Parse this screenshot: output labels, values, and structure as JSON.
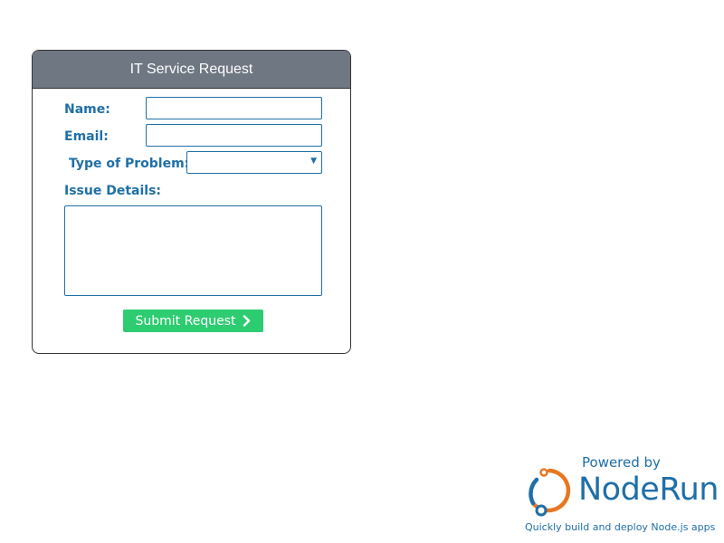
{
  "form": {
    "title": "IT Service Request",
    "name_label": "Name:",
    "name_value": "",
    "email_label": "Email:",
    "email_value": "",
    "problem_label": "Type of Problem:",
    "problem_selected": "",
    "details_label": "Issue Details:",
    "details_value": "",
    "submit_label": "Submit Request"
  },
  "branding": {
    "powered_by": "Powered by",
    "name": "NodeRun",
    "tagline": "Quickly build and deploy Node.js apps"
  },
  "colors": {
    "header_bg": "#6f7782",
    "label": "#1f6fa8",
    "submit_bg": "#2ecc71",
    "logo_orange": "#e87722",
    "logo_blue": "#1f6fa8"
  },
  "icons": {
    "submit": "chevron-right-icon",
    "select": "dropdown-arrow-icon",
    "logo": "noderun-logo-icon"
  }
}
